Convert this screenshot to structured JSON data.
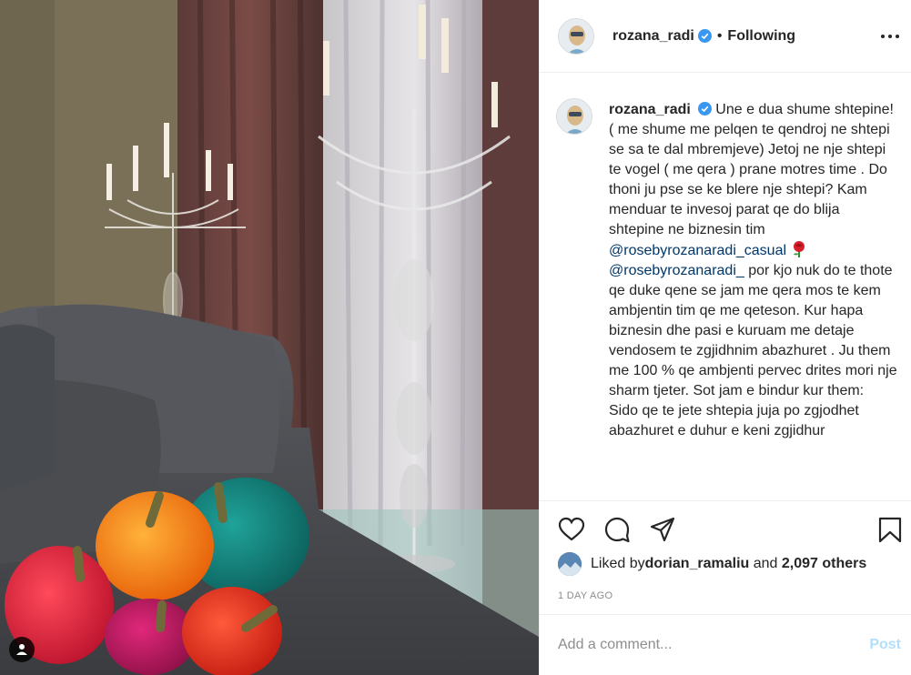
{
  "post": {
    "username": "rozana_radi",
    "follow_status": "Following",
    "separator": "•",
    "caption_parts": [
      "Une e dua shume shtepine! ( me shume me pelqen te qendroj ne shtepi se sa te dal mbremjeve) Jetoj ne nje shtepi te vogel ( me qera ) prane motres time . Do thoni ju pse se ke blere nje shtepi? Kam menduar te invesoj parat qe do blija shtepine ne biznesin tim ",
      "@rosebyrozanaradi_casual",
      "@rosebyrozanaradi_",
      " por kjo nuk do te thote qe duke qene se jam me qera mos te kem ambjentin tim qe me qeteson. Kur hapa biznesin dhe pasi e kuruam me detaje vendosem te zgjidhnim abazhuret . Ju them me 100 % qe ambjenti pervec drites mori nje sharm tjeter. Sot jam e bindur kur them:",
      "Sido qe te jete shtepia juja po zgjodhet abazhuret e duhur e keni zgjidhur"
    ],
    "liked_by_prefix": "Liked by ",
    "liked_by_user": "dorian_ramaliu",
    "liked_by_and": " and ",
    "liked_by_others": "2,097 others",
    "time_ago": "1 DAY AGO",
    "comment_placeholder": "Add a comment...",
    "post_label": "Post"
  },
  "icons": {
    "verified": "verified-badge-icon",
    "more": "more-options-icon",
    "like": "heart-icon",
    "comment": "comment-icon",
    "share": "share-icon",
    "save": "bookmark-icon",
    "tag": "user-tag-icon",
    "rose": "rose-emoji-icon"
  },
  "colors": {
    "verified": "#3897f0",
    "link": "#00376b",
    "post_disabled": "#b2dffc",
    "muted": "#8e8e8e"
  }
}
